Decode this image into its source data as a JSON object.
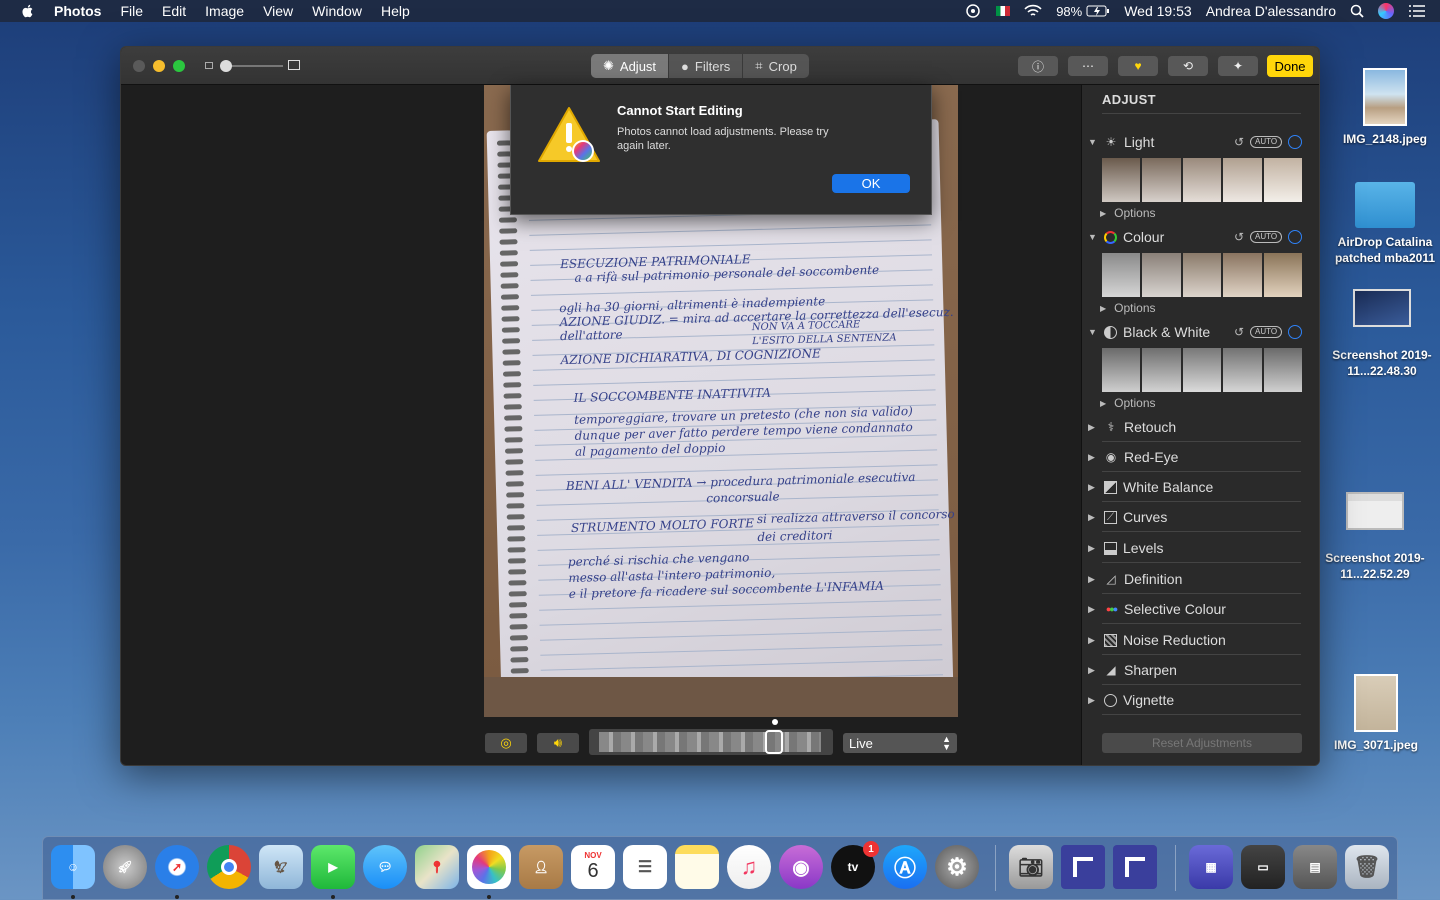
{
  "menubar": {
    "app": "Photos",
    "items": [
      "File",
      "Edit",
      "Image",
      "View",
      "Window",
      "Help"
    ],
    "battery": "98%",
    "clock": "Wed 19:53",
    "user": "Andrea D'alessandro"
  },
  "toolbar": {
    "tabs": [
      {
        "label": "Adjust",
        "icon": "adjust-icon",
        "active": true
      },
      {
        "label": "Filters",
        "icon": "filters-icon",
        "active": false
      },
      {
        "label": "Crop",
        "icon": "crop-icon",
        "active": false
      }
    ],
    "done_label": "Done",
    "accent": "#ffd60a"
  },
  "alert": {
    "title": "Cannot Start Editing",
    "message": "Photos cannot load adjustments. Please try again later.",
    "ok_label": "OK",
    "button_color": "#1a74e8"
  },
  "photo": {
    "handwriting": [
      "ESECUZIONE PATRIMONIALE",
      "a a rifà sul patrimonio personale del soccombente",
      "ogli ha 30 giorni, altrimenti è inadempiente",
      "AZIONE GIUDIZ. = mira ad accertare la correttezza dell'esecuz.",
      "dell'attore",
      "NON VA A TOCCARE",
      "L'ESITO DELLA SENTENZA",
      "AZIONE DICHIARATIVA, DI COGNIZIONE",
      "IL SOCCOMBENTE    INATTIVITA",
      "temporeggiare, trovare un pretesto (che non sia valido)",
      "dunque per aver fatto perdere tempo viene condannato",
      "al pagamento del doppio",
      "BENI ALL' VENDITA → procedura patrimoniale esecutiva",
      "concorsuale",
      "si realizza attraverso il concorso",
      "STRUMENTO MOLTO FORTE",
      "dei creditori",
      "perché si rischia che vengano",
      "messo all'asta l'intero patrimonio,",
      "e il pretore fa ricadere sul soccombente L'INFAMIA"
    ]
  },
  "bottom": {
    "live_select": "Live"
  },
  "sidebar": {
    "title": "ADJUST",
    "auto_label": "AUTO",
    "options_label": "Options",
    "expanded": [
      {
        "label": "Light",
        "icon": "sun-icon"
      },
      {
        "label": "Colour",
        "icon": "colour-wheel-icon"
      },
      {
        "label": "Black & White",
        "icon": "half-circle-icon"
      }
    ],
    "collapsed": [
      {
        "label": "Retouch",
        "icon": "bandage-icon"
      },
      {
        "label": "Red-Eye",
        "icon": "eye-icon"
      },
      {
        "label": "White Balance",
        "icon": "white-balance-icon"
      },
      {
        "label": "Curves",
        "icon": "curves-icon"
      },
      {
        "label": "Levels",
        "icon": "levels-icon"
      },
      {
        "label": "Definition",
        "icon": "triangle-icon"
      },
      {
        "label": "Selective Colour",
        "icon": "dots-icon"
      },
      {
        "label": "Noise Reduction",
        "icon": "noise-icon"
      },
      {
        "label": "Sharpen",
        "icon": "sharpen-icon"
      },
      {
        "label": "Vignette",
        "icon": "vignette-icon"
      }
    ],
    "reset_label": "Reset Adjustments"
  },
  "desktop": [
    {
      "label": "IMG_2148.jpeg",
      "kind": "photo"
    },
    {
      "label": "AirDrop Catalina patched mba2011",
      "kind": "folder"
    },
    {
      "label": "Screenshot 2019-11...22.48.30",
      "kind": "screenshot"
    },
    {
      "label": "Screenshot 2019-11...22.52.29",
      "kind": "screenshot"
    },
    {
      "label": "IMG_3071.jpeg",
      "kind": "photo"
    }
  ],
  "dock": {
    "calendar_month": "NOV",
    "calendar_day": "6",
    "tv_badge": "1",
    "tv_label": "tv"
  }
}
